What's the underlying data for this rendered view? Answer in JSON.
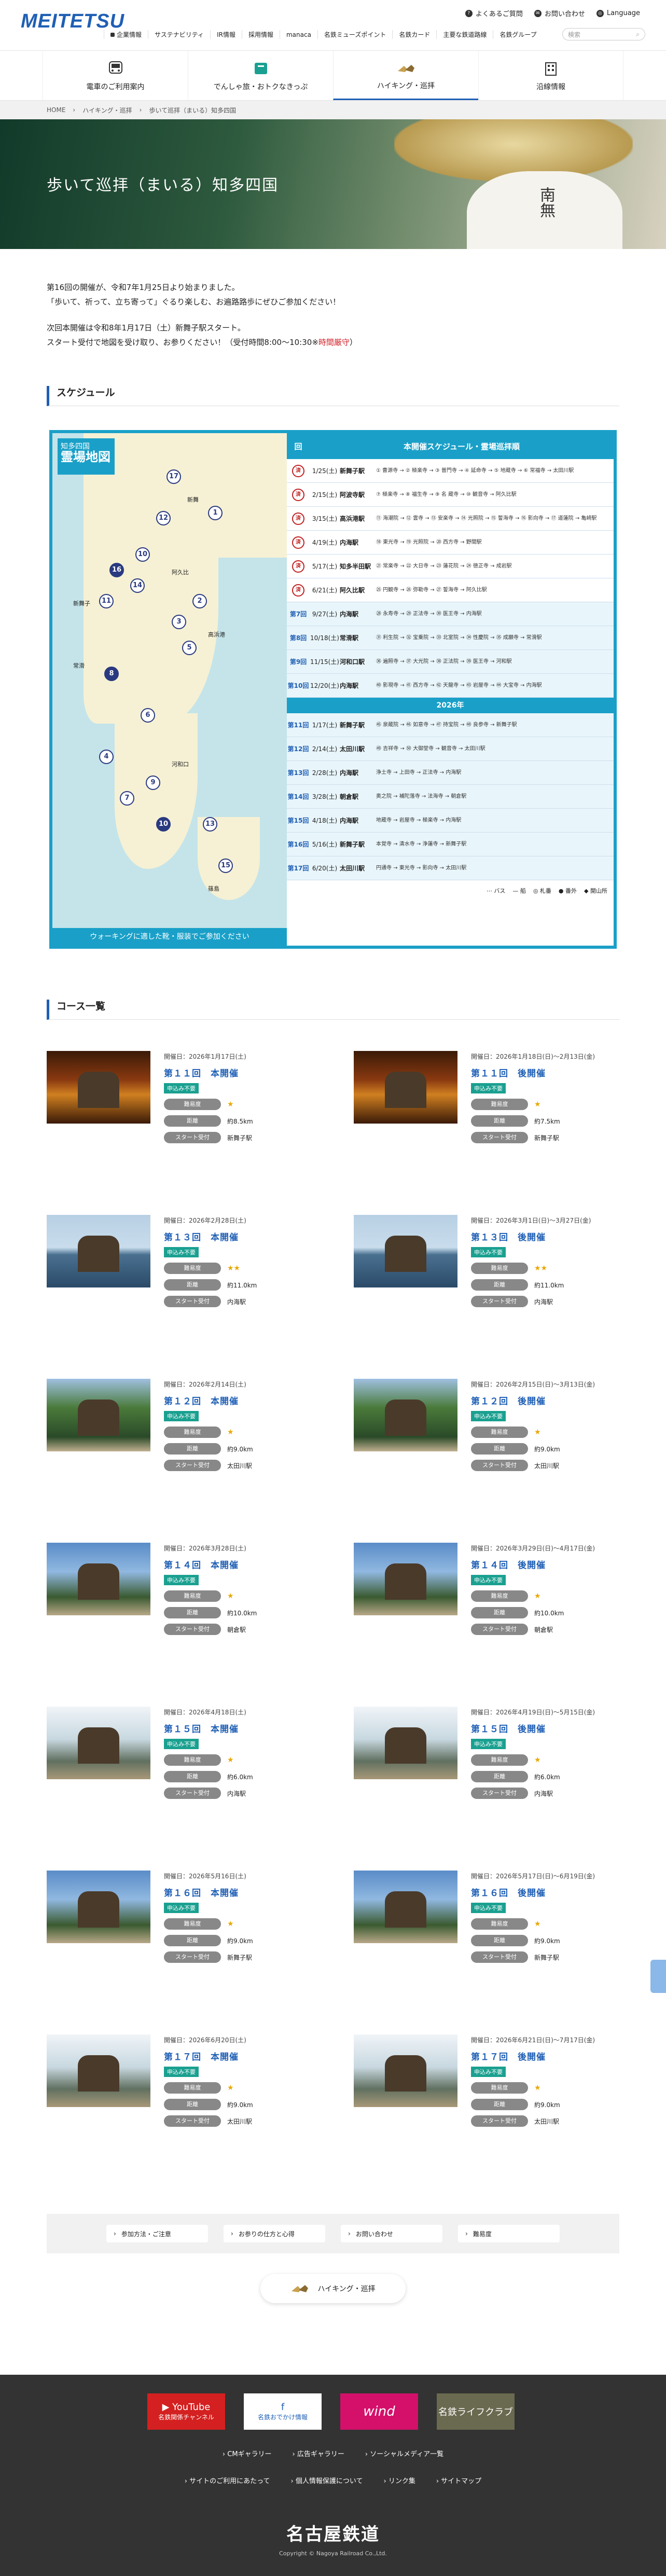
{
  "header": {
    "logo": "MEITETSU",
    "util": [
      {
        "icon": "question-icon",
        "label": "よくあるご質問"
      },
      {
        "icon": "mail-icon",
        "label": "お問い合わせ"
      },
      {
        "icon": "globe-icon",
        "label": "Language"
      }
    ],
    "search_placeholder": "検索",
    "global_nav": [
      "企業情報",
      "サステナビリティ",
      "IR情報",
      "採用情報",
      "manaca",
      "名鉄ミューズポイント",
      "名鉄カード",
      "主要な鉄道路線",
      "名鉄グループ"
    ]
  },
  "sub_nav": [
    {
      "label": "電車のご利用案内",
      "active": false
    },
    {
      "label": "でんしゃ旅・おトクなきっぷ",
      "active": false
    },
    {
      "label": "ハイキング・巡拝",
      "active": true
    },
    {
      "label": "沿線情報",
      "active": false
    }
  ],
  "breadcrumb": [
    "HOME",
    "ハイキング・巡拝",
    "歩いて巡拝（まいる）知多四国"
  ],
  "hero": {
    "title": "歩いて巡拝（まいる）知多四国"
  },
  "intro": {
    "l1": "第16回の開催が、令和7年1月25日より始まりました。",
    "l2": "「歩いて、祈って、立ち寄って」ぐるり楽しむ、お遍路路歩にぜひご参加ください！",
    "l3": "次回本開催は令和8年1月17日（土）新舞子駅スタート。",
    "l4a": "スタート受付で地図を受け取り、お参りください！（受付時間8:00〜10:30※",
    "l4b": "時間厳守",
    "l4c": "）"
  },
  "sec_schedule": "スケジュール",
  "sec_courses": "コース一覧",
  "map": {
    "title_small": "知多四国",
    "title_big": "霊場地図",
    "footer": "ウォーキングに適した靴・服装でご参加ください"
  },
  "schedule": {
    "header_no": "回",
    "header_title": "本開催スケジュール・霊場巡拝順",
    "year_label": "2026年",
    "rows": [
      {
        "no": "済",
        "date": "1/25(土)",
        "station": "新舞子駅",
        "temples": "① 曹源寺 → ② 極楽寺 → ③ 普門寺 → ④ 延命寺 → ⑤ 地蔵寺 → ⑥ 常福寺 → 太田川駅"
      },
      {
        "no": "済",
        "date": "2/15(土)",
        "station": "阿波寺駅",
        "temples": "⑦ 極楽寺 → ⑧ 福生寺 → ⑨ 名 蔵寺 → ⑩ 観音寺 → 阿久比駅"
      },
      {
        "no": "済",
        "date": "3/15(土)",
        "station": "高浜港駅",
        "temples": "⑪ 海潮院 → ⑫ 雲寺 → ⑬ 安楽寺 → ⑭ 光照院 → ⑮ 誓海寺 → ⑯ 影向寺 → ⑰ 道蓮院 → 亀崎駅"
      },
      {
        "no": "済",
        "date": "4/19(土)",
        "station": "内海駅",
        "temples": "⑱ 東光寺 → ⑲ 光照院 → ⑳ 西方寺 → 野間駅"
      },
      {
        "no": "済",
        "date": "5/17(土)",
        "station": "知多半田駅",
        "temples": "㉑ 常楽寺 → ㉒ 大日寺 → ㉓ 蓮花院 → ㉔ 徳正寺 → 成岩駅"
      },
      {
        "no": "済",
        "date": "6/21(土)",
        "station": "阿久比駅",
        "temples": "㉕ 円観寺 → ㉖ 弥勒寺 → ㉗ 誓海寺 → 阿久比駅"
      },
      {
        "no": "第7回",
        "date": "9/27(土)",
        "station": "内海駅",
        "temples": "㉘ 永寿寺 → ㉙ 正法寺 → ㉚ 医王寺 → 内海駅"
      },
      {
        "no": "第8回",
        "date": "10/18(土)",
        "station": "常滑駅",
        "temples": "㉛ 利生院 → ㉜ 宝乗院 → ㉝ 北室院 → ㉞ 性慶院 → ㉟ 成願寺 → 常滑駅"
      },
      {
        "no": "第9回",
        "date": "11/15(土)",
        "station": "河和口駅",
        "temples": "㊱ 遍照寺 → ㊲ 大光院 → ㊳ 正法院 → ㊴ 医王寺 → 河和駅"
      },
      {
        "no": "第10回",
        "date": "12/20(土)",
        "station": "内海駅",
        "temples": "㊵ 影現寺 → ㊶ 西方寺 → ㊷ 天龍寺 → ㊸ 岩屋寺 → ㊹ 大宝寺 → 内海駅"
      },
      {
        "no": "第11回",
        "date": "1/17(土)",
        "station": "新舞子駅",
        "temples": "㊺ 泉蔵院 → ㊻ 如意寺 → ㊼ 持宝院 → ㊽ 良参寺 → 新舞子駅"
      },
      {
        "no": "第12回",
        "date": "2/14(土)",
        "station": "太田川駅",
        "temples": "㊾ 吉祥寺 → ㊿ 大御堂寺 → 観音寺 → 太田川駅"
      },
      {
        "no": "第13回",
        "date": "2/28(土)",
        "station": "内海駅",
        "temples": "浄土寺 → 上田寺 → 正法寺 → 内海駅"
      },
      {
        "no": "第14回",
        "date": "3/28(土)",
        "station": "朝倉駅",
        "temples": "奥之院 → 補陀落寺 → 法海寺 → 朝倉駅"
      },
      {
        "no": "第15回",
        "date": "4/18(土)",
        "station": "内海駅",
        "temples": "地蔵寺 → 岩屋寺 → 極楽寺 → 内海駅"
      },
      {
        "no": "第16回",
        "date": "5/16(土)",
        "station": "新舞子駅",
        "temples": "本覚寺 → 清水寺 → 浄蓮寺 → 新舞子駅"
      },
      {
        "no": "第17回",
        "date": "6/20(土)",
        "station": "太田川駅",
        "temples": "円通寺 → 東光寺 → 影向寺 → 太田川駅"
      }
    ],
    "legend": [
      "バス",
      "船",
      "札番",
      "番外",
      "開山所"
    ]
  },
  "labels": {
    "badge": "申込み不要",
    "difficulty": "難易度",
    "distance": "距離",
    "start": "スタート受付"
  },
  "courses": [
    {
      "date": "開催日：2026年1月17日(土)",
      "title": "第１１回　本開催",
      "stars": "★",
      "distance": "約8.5km",
      "start": "新舞子駅"
    },
    {
      "date": "開催日：2026年1月18日(日)〜2月13日(金)",
      "title": "第１１回　後開催",
      "stars": "★",
      "distance": "約7.5km",
      "start": "新舞子駅"
    },
    {
      "date": "開催日：2026年2月28日(土)",
      "title": "第１３回　本開催",
      "stars": "★★",
      "distance": "約11.0km",
      "start": "内海駅"
    },
    {
      "date": "開催日：2026年3月1日(日)〜3月27日(金)",
      "title": "第１３回　後開催",
      "stars": "★★",
      "distance": "約11.0km",
      "start": "内海駅"
    },
    {
      "date": "開催日：2026年2月14日(土)",
      "title": "第１２回　本開催",
      "stars": "★",
      "distance": "約9.0km",
      "start": "太田川駅"
    },
    {
      "date": "開催日：2026年2月15日(日)〜3月13日(金)",
      "title": "第１２回　後開催",
      "stars": "★",
      "distance": "約9.0km",
      "start": "太田川駅"
    },
    {
      "date": "開催日：2026年3月28日(土)",
      "title": "第１４回　本開催",
      "stars": "★",
      "distance": "約10.0km",
      "start": "朝倉駅"
    },
    {
      "date": "開催日：2026年3月29日(日)〜4月17日(金)",
      "title": "第１４回　後開催",
      "stars": "★",
      "distance": "約10.0km",
      "start": "朝倉駅"
    },
    {
      "date": "開催日：2026年4月18日(土)",
      "title": "第１５回　本開催",
      "stars": "★",
      "distance": "約6.0km",
      "start": "内海駅"
    },
    {
      "date": "開催日：2026年4月19日(日)〜5月15日(金)",
      "title": "第１５回　後開催",
      "stars": "★",
      "distance": "約6.0km",
      "start": "内海駅"
    },
    {
      "date": "開催日：2026年5月16日(土)",
      "title": "第１６回　本開催",
      "stars": "★",
      "distance": "約9.0km",
      "start": "新舞子駅"
    },
    {
      "date": "開催日：2026年5月17日(日)〜6月19日(金)",
      "title": "第１６回　後開催",
      "stars": "★",
      "distance": "約9.0km",
      "start": "新舞子駅"
    },
    {
      "date": "開催日：2026年6月20日(土)",
      "title": "第１７回　本開催",
      "stars": "★",
      "distance": "約9.0km",
      "start": "太田川駅"
    },
    {
      "date": "開催日：2026年6月21日(日)〜7月17日(金)",
      "title": "第１７回　後開催",
      "stars": "★",
      "distance": "約9.0km",
      "start": "太田川駅"
    }
  ],
  "bottom_links": [
    "参加方法・ご注意",
    "お参りの仕方と心得",
    "お問い合わせ",
    "難易度"
  ],
  "back_button": "ハイキング・巡拝",
  "footer": {
    "banners": [
      "名鉄関係チャンネル",
      "名鉄おでかけ情報",
      "wind",
      "名鉄ライフクラブ"
    ],
    "links_row1": [
      "CMギャラリー",
      "広告ギャラリー",
      "ソーシャルメディア一覧"
    ],
    "links_row2": [
      "サイトのご利用にあたって",
      "個人情報保護について",
      "リンク集",
      "サイトマップ"
    ],
    "corp": "名古屋鉄道",
    "copyright": "Copyright © Nagoya Railroad Co.,Ltd."
  }
}
